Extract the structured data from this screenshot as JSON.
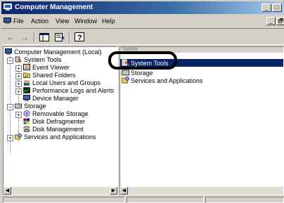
{
  "window": {
    "title": "Computer Management",
    "title_controls": [
      "_",
      "□"
    ],
    "mdi_controls": [
      "_",
      "🗗"
    ]
  },
  "menu": {
    "items": [
      "File",
      "Action",
      "View",
      "Window",
      "Help"
    ]
  },
  "toolbar": {
    "back": "←",
    "forward": "→",
    "up_icon": "show-hide-tree-icon",
    "export_icon": "export-list-icon",
    "help_icon": "help-icon"
  },
  "tree": {
    "items": [
      {
        "label": "Computer Management (Local)"
      },
      {
        "label": "System Tools"
      },
      {
        "label": "Event Viewer"
      },
      {
        "label": "Shared Folders"
      },
      {
        "label": "Local Users and Groups"
      },
      {
        "label": "Performance Logs and Alerts"
      },
      {
        "label": "Device Manager"
      },
      {
        "label": "Storage"
      },
      {
        "label": "Removable Storage"
      },
      {
        "label": "Disk Defragmenter"
      },
      {
        "label": "Disk Management"
      },
      {
        "label": "Services and Applications"
      }
    ]
  },
  "list": {
    "column": "Name",
    "items": [
      {
        "label": "System Tools",
        "selected": true
      },
      {
        "label": "Storage",
        "selected": false
      },
      {
        "label": "Services and Applications",
        "selected": false
      }
    ]
  },
  "scroll": {
    "left": "◀",
    "right": "▶"
  },
  "colors": {
    "selection": "#0a246a",
    "titlebar": "#0a246a",
    "face": "#d4d0c8"
  }
}
